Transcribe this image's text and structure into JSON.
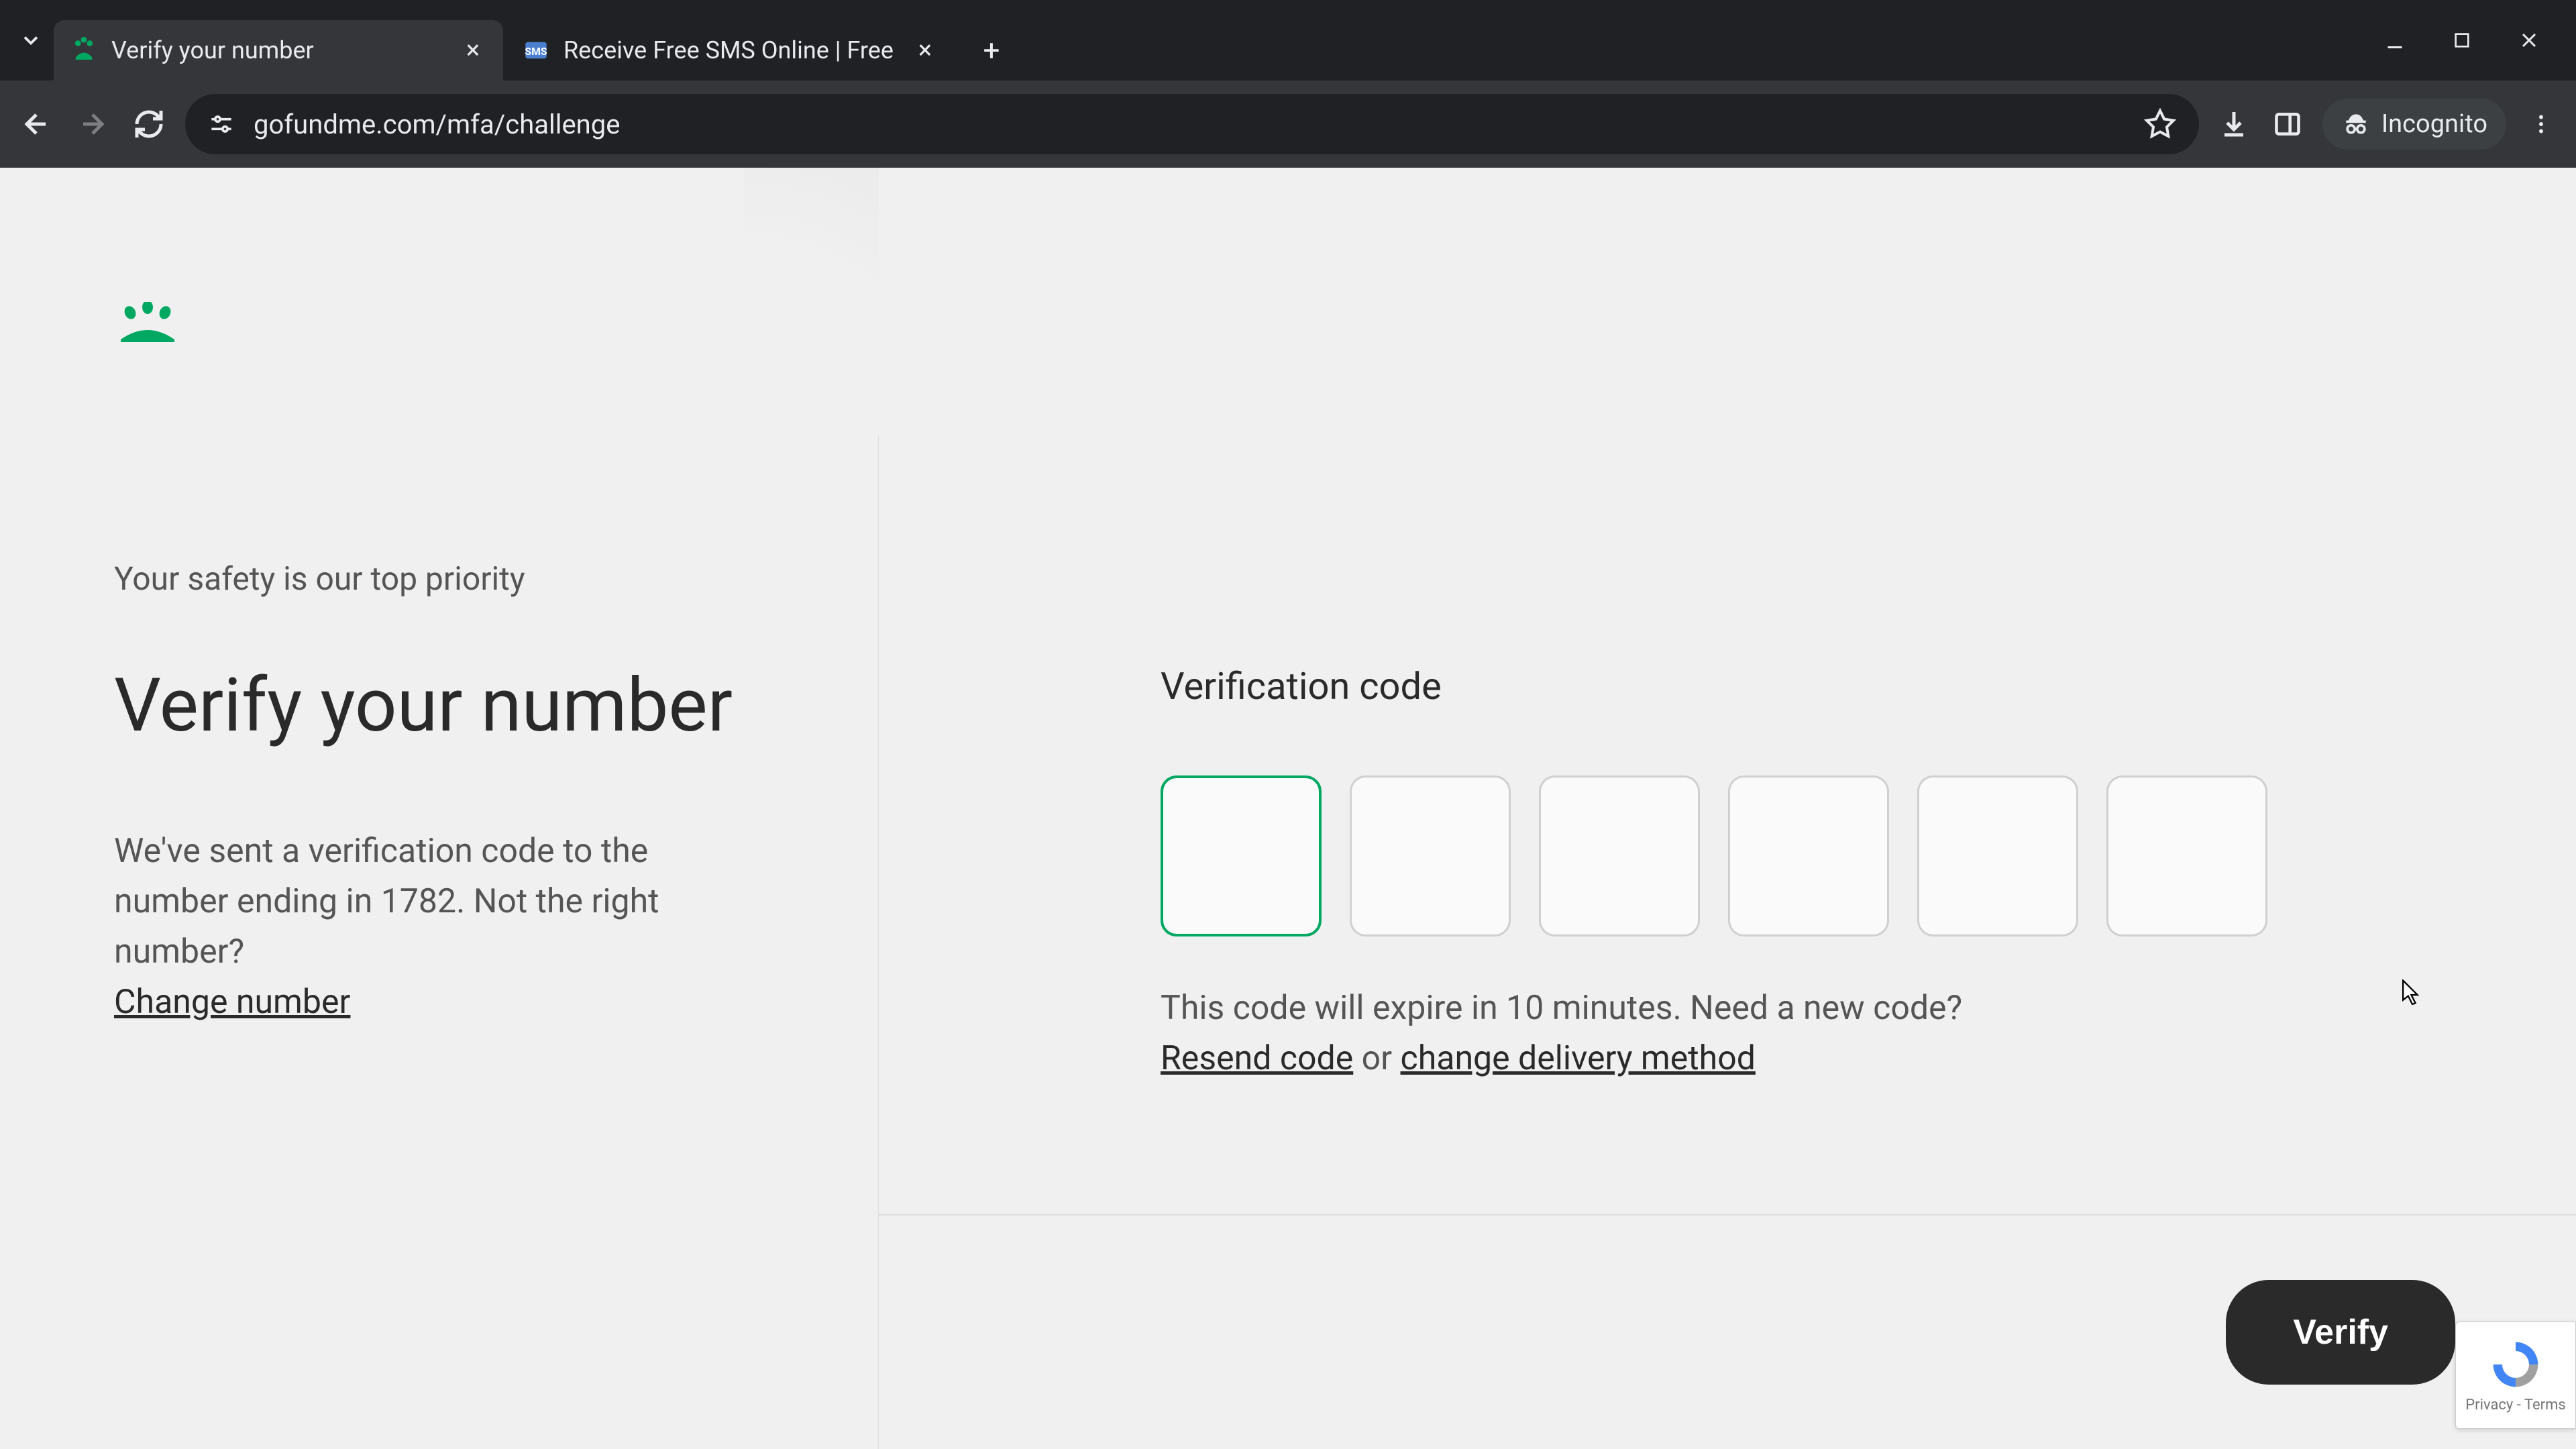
{
  "browser": {
    "tabs": [
      {
        "title": "Verify your number",
        "active": true
      },
      {
        "title": "Receive Free SMS Online | Free",
        "active": false
      }
    ],
    "url": "gofundme.com/mfa/challenge",
    "incognito_label": "Incognito"
  },
  "page": {
    "subtitle": "Your safety is our top priority",
    "title": "Verify your number",
    "description_part1": "We've sent a verification code to the number ending in 1782. Not the right number?",
    "change_number_link": "Change number",
    "field_label": "Verification code",
    "code_digits": 6,
    "help_text_part1": "This code will expire in 10 minutes. Need a new code?",
    "resend_link": "Resend code",
    "help_text_or": " or ",
    "change_delivery_link": "change delivery method",
    "verify_button": "Verify",
    "recaptcha_footer": "Privacy - Terms"
  },
  "colors": {
    "brand_green": "#00a862",
    "text_dark": "#2a2a2a",
    "text_muted": "#555"
  }
}
